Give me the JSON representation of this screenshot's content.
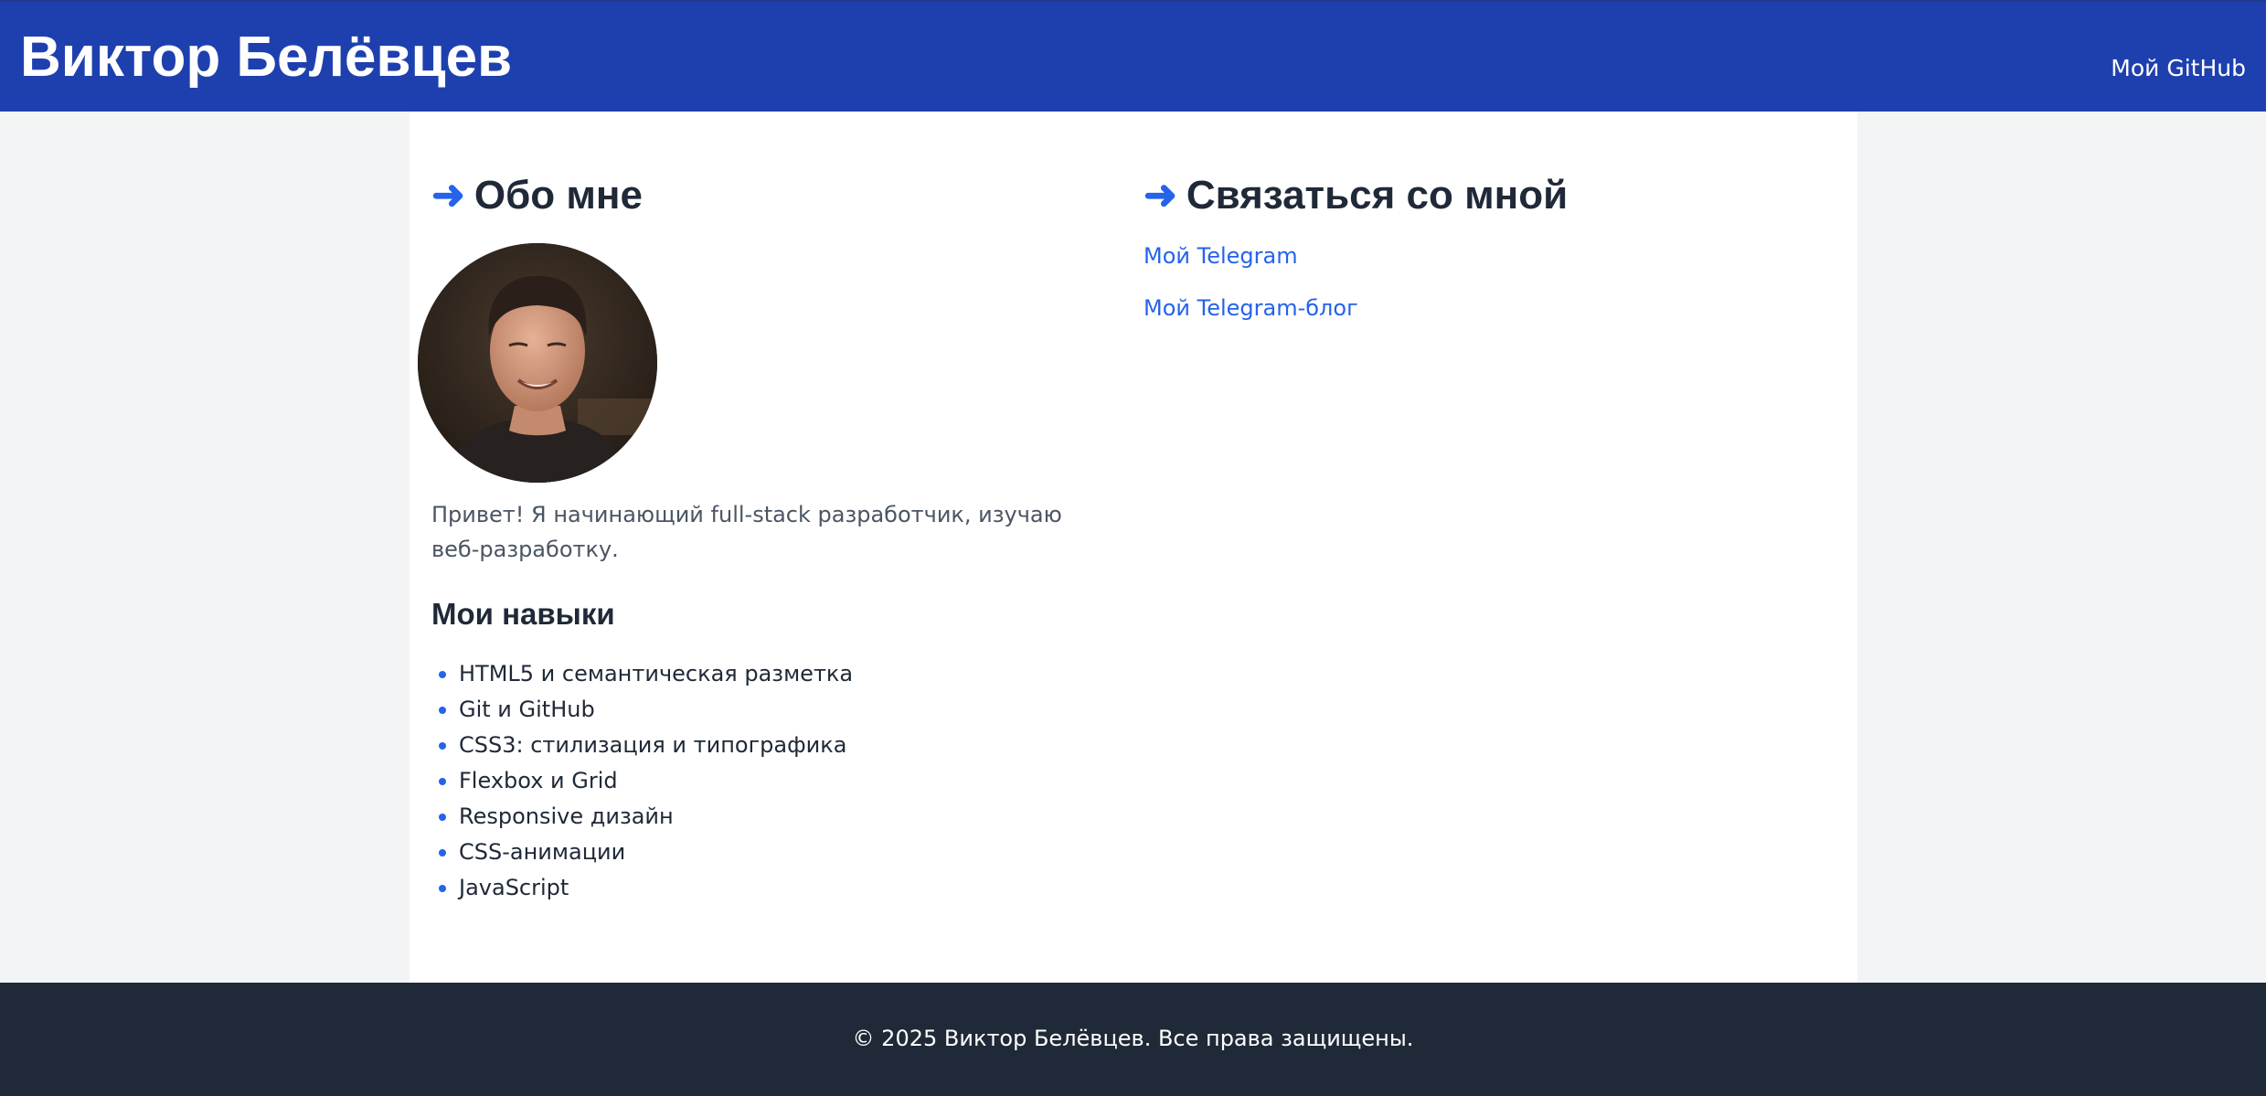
{
  "header": {
    "title": "Виктор Белёвцев",
    "nav_github": "Мой GitHub"
  },
  "about": {
    "arrow": "➜",
    "heading": "Обо мне",
    "intro": "Привет! Я начинающий full-stack разработчик, изучаю веб-разработку.",
    "skills_heading": "Мои навыки",
    "skills": [
      "HTML5 и семантическая разметка",
      "Git и GitHub",
      "CSS3: стилизация и типографика",
      "Flexbox и Grid",
      "Responsive дизайн",
      "CSS-анимации",
      "JavaScript"
    ]
  },
  "contact": {
    "arrow": "➜",
    "heading": "Связаться со мной",
    "links": [
      "Мой Telegram",
      "Мой Telegram-блог"
    ]
  },
  "footer": {
    "text": "© 2025 Виктор Белёвцев. Все права защищены."
  },
  "colors": {
    "header_bg": "#1e40af",
    "accent": "#2563eb",
    "footer_bg": "#1f2937",
    "page_bg": "#f3f4f6",
    "heading_text": "#1f2937"
  },
  "icons": {
    "section_arrow": "right-arrow-icon",
    "list_bullet": "bullet-icon"
  }
}
